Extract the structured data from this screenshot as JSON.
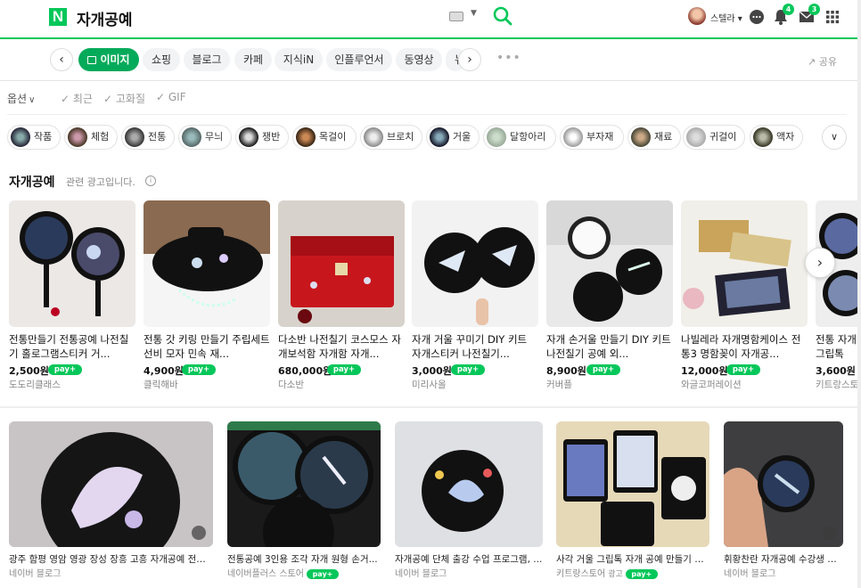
{
  "header": {
    "logo": "N",
    "query": "자개공예",
    "user_name": "스텔라",
    "notification_count": "4",
    "mail_count": "3",
    "brand_color": "#03c75a"
  },
  "tabs": {
    "items": [
      {
        "label": "이미지",
        "active": true
      },
      {
        "label": "쇼핑"
      },
      {
        "label": "블로그"
      },
      {
        "label": "카페"
      },
      {
        "label": "지식iN"
      },
      {
        "label": "인플루언서"
      },
      {
        "label": "동영상"
      },
      {
        "label": "뉴"
      }
    ],
    "share_label": "공유"
  },
  "filters": {
    "option_label": "옵션",
    "items": [
      "최근",
      "고화질",
      "GIF"
    ]
  },
  "chips": [
    {
      "label": "작품"
    },
    {
      "label": "체험"
    },
    {
      "label": "전통"
    },
    {
      "label": "무늬"
    },
    {
      "label": "쟁반"
    },
    {
      "label": "목걸이"
    },
    {
      "label": "브로치"
    },
    {
      "label": "거울"
    },
    {
      "label": "달항아리"
    },
    {
      "label": "부자재"
    },
    {
      "label": "재료"
    },
    {
      "label": "귀걸이"
    },
    {
      "label": "액자"
    }
  ],
  "ad_section": {
    "title": "자개공예",
    "subtitle": "관련 광고입니다.",
    "products": [
      {
        "title": "전통만들기 전통공예 나전칠기 홀로그램스티커 거...",
        "price": "2,500원",
        "store": "도도리클래스"
      },
      {
        "title": "전통 갓 키링 만들기 주립세트 선비 모자 민속 재...",
        "price": "4,900원",
        "store": "클릭해바"
      },
      {
        "title": "다소반 나전칠기 코스모스 자개보석함 자개함 자개...",
        "price": "680,000원",
        "store": "다소반"
      },
      {
        "title": "자개 거울 꾸미기 DIY 키트 자개스티커 나전칠기...",
        "price": "3,000원",
        "store": "미리사올"
      },
      {
        "title": "자개 손거울 만들기 DIY 키트 나전칠기 공예 외...",
        "price": "8,900원",
        "store": "커버플"
      },
      {
        "title": "나빌레라 자개명함케이스 전통3 명함꽂이 자개공...",
        "price": "12,000원",
        "store": "와글코퍼레이션"
      },
      {
        "title": "전통 자개 그립톡 만...",
        "price": "3,600원",
        "store": "키트랑스토어"
      }
    ],
    "npay_label": "pay+"
  },
  "image_results": [
    {
      "title": "광주 함평 영암 영광 장성 장흥 고흥 자개공예 전통...",
      "source": "네이버 블로그"
    },
    {
      "title": "전통공예 3인용 조각 자개 원형 손거...",
      "source": "네이버플러스 스토어",
      "npay": true
    },
    {
      "title": "자개공예 단체 출강 수업 프로그램, ...",
      "source": "네이버 블로그"
    },
    {
      "title": "사각 거울 그립톡 자개 공예 만들기 D...",
      "source": "키트랑스토어",
      "ad": "광고",
      "npay": true
    },
    {
      "title": "휘황찬란 자개공예 수강생 베...",
      "source": "네이버 블로그"
    }
  ]
}
